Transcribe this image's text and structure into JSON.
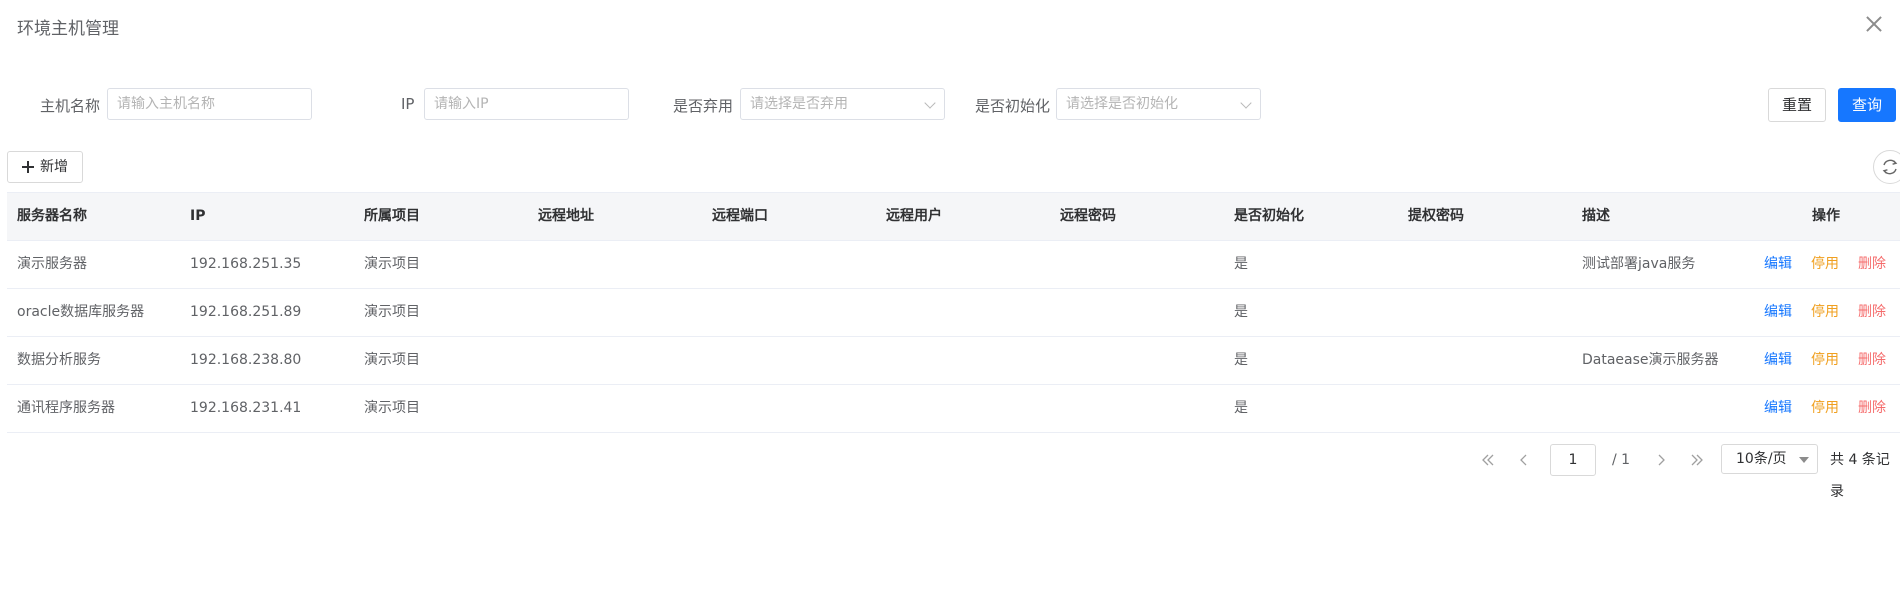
{
  "dialog": {
    "title": "环境主机管理"
  },
  "filters": {
    "host_name_label": "主机名称",
    "host_name_placeholder": "请输入主机名称",
    "ip_label": "IP",
    "ip_placeholder": "请输入IP",
    "deprecated_label": "是否弃用",
    "deprecated_placeholder": "请选择是否弃用",
    "initialized_label": "是否初始化",
    "initialized_placeholder": "请选择是否初始化"
  },
  "actions": {
    "reset": "重置",
    "query": "查询",
    "add": "新增"
  },
  "table": {
    "headers": [
      "服务器名称",
      "IP",
      "所属项目",
      "远程地址",
      "远程端口",
      "远程用户",
      "远程密码",
      "是否初始化",
      "提权密码",
      "描述",
      "操作"
    ],
    "rows": [
      {
        "name": "演示服务器",
        "ip": "192.168.251.35",
        "project": "演示项目",
        "initialized": "是",
        "desc": "测试部署java服务"
      },
      {
        "name": "oracle数据库服务器",
        "ip": "192.168.251.89",
        "project": "演示项目",
        "initialized": "是",
        "desc": ""
      },
      {
        "name": "数据分析服务",
        "ip": "192.168.238.80",
        "project": "演示项目",
        "initialized": "是",
        "desc": "Dataease演示服务器"
      },
      {
        "name": "通讯程序服务器",
        "ip": "192.168.231.41",
        "project": "演示项目",
        "initialized": "是",
        "desc": ""
      }
    ],
    "row_actions": {
      "edit": "编辑",
      "disable": "停用",
      "delete": "删除"
    }
  },
  "pagination": {
    "current_page": "1",
    "total_pages_text": "/ 1",
    "page_size": "10条/页",
    "total_text": "共 4 条记录"
  },
  "colors": {
    "primary": "#1677ff",
    "warning": "#f0a020",
    "danger": "#f56c6c"
  }
}
